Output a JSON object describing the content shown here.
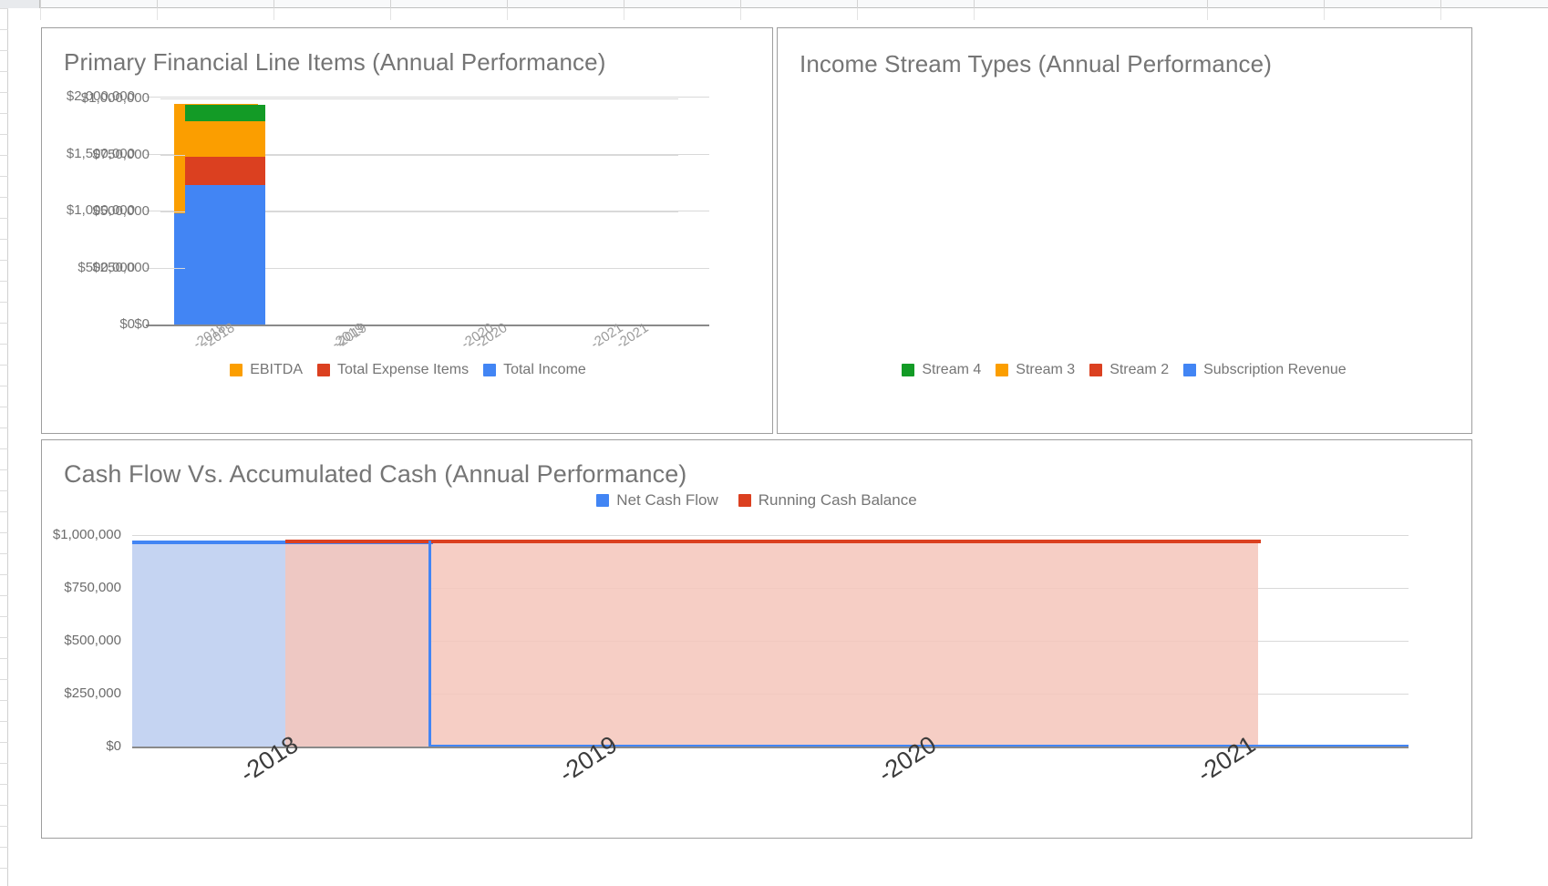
{
  "app": {
    "context": "spreadsheet-with-embedded-charts",
    "background": "#ffffff"
  },
  "colors": {
    "blue": "#4285f4",
    "red": "#db4020",
    "orange": "#fb9e00",
    "green": "#139b26",
    "gridline": "#d9d9d9",
    "axis": "#8a8a8a",
    "title_text": "#757575",
    "tick_text": "#9a9a9a",
    "card_border": "#9e9e9e",
    "blue_fill": "#c5d4f2",
    "red_fill": "#f4c6bb"
  },
  "charts": [
    {
      "id": "primary-financial-line-items",
      "title": "Primary Financial Line Items (Annual Performance)",
      "yticks": [
        "$2,000,000",
        "$1,500,000",
        "$1,000,000",
        "$500,000",
        "$0"
      ],
      "xticks": [
        "-2018",
        "-2019",
        "-2020",
        "-2021"
      ],
      "legend": [
        {
          "label": "EBITDA",
          "color": "#fb9e00"
        },
        {
          "label": "Total Expense Items",
          "color": "#db4020"
        },
        {
          "label": "Total Income",
          "color": "#4285f4"
        }
      ]
    },
    {
      "id": "income-stream-types",
      "title": "Income Stream Types (Annual Performance)",
      "yticks": [
        "$1,000,000",
        "$750,000",
        "$500,000",
        "$250,000",
        "$0"
      ],
      "xticks": [
        "-2018",
        "-2019",
        "-2020",
        "-2021"
      ],
      "legend": [
        {
          "label": "Stream 4",
          "color": "#139b26"
        },
        {
          "label": "Stream 3",
          "color": "#fb9e00"
        },
        {
          "label": "Stream 2",
          "color": "#db4020"
        },
        {
          "label": "Subscription Revenue",
          "color": "#4285f4"
        }
      ]
    },
    {
      "id": "cash-flow-vs-accumulated-cash",
      "title": "Cash Flow Vs. Accumulated Cash (Annual Performance)",
      "yticks": [
        "$1,000,000",
        "$750,000",
        "$500,000",
        "$250,000",
        "$0"
      ],
      "xticks": [
        "-2018",
        "-2019",
        "-2020",
        "-2021"
      ],
      "legend": [
        {
          "label": "Net Cash Flow",
          "color": "#4285f4"
        },
        {
          "label": "Running Cash Balance",
          "color": "#db4020"
        }
      ]
    }
  ],
  "chart_data": [
    {
      "type": "bar",
      "stacked": true,
      "title": "Primary Financial Line Items (Annual Performance)",
      "xlabel": "",
      "ylabel": "",
      "categories": [
        "2018",
        "2019",
        "2020",
        "2021"
      ],
      "ylim": [
        0,
        2000000
      ],
      "yticks": [
        0,
        500000,
        1000000,
        1500000,
        2000000
      ],
      "ytick_labels": [
        "$0",
        "$500,000",
        "$1,000,000",
        "$1,500,000",
        "$2,000,000"
      ],
      "xtick_labels": [
        "-2018",
        "-2019",
        "-2020",
        "-2021"
      ],
      "grid": true,
      "legend_position": "bottom",
      "series": [
        {
          "name": "Total Income",
          "color": "#4285f4",
          "values": [
            980000,
            0,
            0,
            0
          ]
        },
        {
          "name": "Total Expense Items",
          "color": "#db4020",
          "values": [
            0,
            0,
            0,
            0
          ]
        },
        {
          "name": "EBITDA",
          "color": "#fb9e00",
          "values": [
            960000,
            0,
            0,
            0
          ]
        }
      ]
    },
    {
      "type": "bar",
      "stacked": true,
      "title": "Income Stream Types (Annual Performance)",
      "xlabel": "",
      "ylabel": "",
      "categories": [
        "2018",
        "2019",
        "2020",
        "2021"
      ],
      "ylim": [
        0,
        1000000
      ],
      "yticks": [
        0,
        250000,
        500000,
        750000,
        1000000
      ],
      "ytick_labels": [
        "$0",
        "$250,000",
        "$500,000",
        "$750,000",
        "$1,000,000"
      ],
      "xtick_labels": [
        "-2018",
        "-2019",
        "-2020",
        "-2021"
      ],
      "grid": true,
      "legend_position": "bottom",
      "series": [
        {
          "name": "Subscription Revenue",
          "color": "#4285f4",
          "values": [
            615000,
            0,
            0,
            0
          ]
        },
        {
          "name": "Stream 2",
          "color": "#db4020",
          "values": [
            125000,
            0,
            0,
            0
          ]
        },
        {
          "name": "Stream 3",
          "color": "#fb9e00",
          "values": [
            160000,
            0,
            0,
            0
          ]
        },
        {
          "name": "Stream 4",
          "color": "#139b26",
          "values": [
            70000,
            0,
            0,
            0
          ]
        }
      ]
    },
    {
      "type": "area",
      "title": "Cash Flow Vs. Accumulated Cash (Annual Performance)",
      "xlabel": "",
      "ylabel": "",
      "categories": [
        "2018",
        "2019",
        "2020",
        "2021"
      ],
      "ylim": [
        0,
        1000000
      ],
      "yticks": [
        0,
        250000,
        500000,
        750000,
        1000000
      ],
      "ytick_labels": [
        "$0",
        "$250,000",
        "$500,000",
        "$750,000",
        "$1,000,000"
      ],
      "xtick_labels": [
        "-2018",
        "-2019",
        "-2020",
        "-2021"
      ],
      "grid": true,
      "legend_position": "top",
      "series": [
        {
          "name": "Net Cash Flow",
          "color": "#4285f4",
          "values": [
            965000,
            0,
            0,
            0
          ]
        },
        {
          "name": "Running Cash Balance",
          "color": "#db4020",
          "values": [
            965000,
            965000,
            965000,
            0
          ]
        }
      ]
    }
  ]
}
